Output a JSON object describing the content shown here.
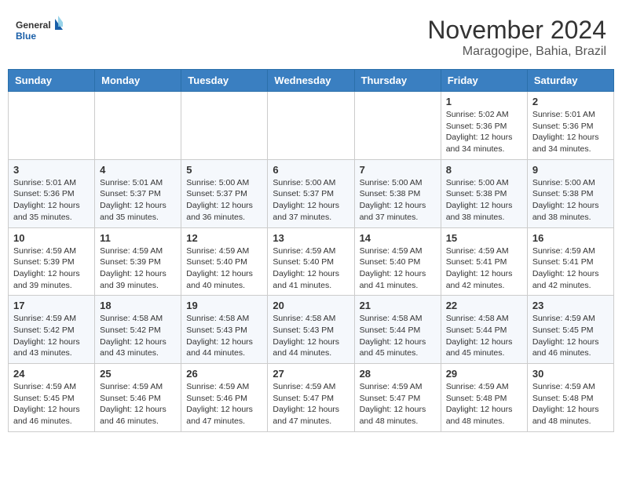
{
  "header": {
    "logo_general": "General",
    "logo_blue": "Blue",
    "month_title": "November 2024",
    "location": "Maragogipe, Bahia, Brazil"
  },
  "days_of_week": [
    "Sunday",
    "Monday",
    "Tuesday",
    "Wednesday",
    "Thursday",
    "Friday",
    "Saturday"
  ],
  "weeks": [
    [
      {
        "day": "",
        "info": ""
      },
      {
        "day": "",
        "info": ""
      },
      {
        "day": "",
        "info": ""
      },
      {
        "day": "",
        "info": ""
      },
      {
        "day": "",
        "info": ""
      },
      {
        "day": "1",
        "info": "Sunrise: 5:02 AM\nSunset: 5:36 PM\nDaylight: 12 hours\nand 34 minutes."
      },
      {
        "day": "2",
        "info": "Sunrise: 5:01 AM\nSunset: 5:36 PM\nDaylight: 12 hours\nand 34 minutes."
      }
    ],
    [
      {
        "day": "3",
        "info": "Sunrise: 5:01 AM\nSunset: 5:36 PM\nDaylight: 12 hours\nand 35 minutes."
      },
      {
        "day": "4",
        "info": "Sunrise: 5:01 AM\nSunset: 5:37 PM\nDaylight: 12 hours\nand 35 minutes."
      },
      {
        "day": "5",
        "info": "Sunrise: 5:00 AM\nSunset: 5:37 PM\nDaylight: 12 hours\nand 36 minutes."
      },
      {
        "day": "6",
        "info": "Sunrise: 5:00 AM\nSunset: 5:37 PM\nDaylight: 12 hours\nand 37 minutes."
      },
      {
        "day": "7",
        "info": "Sunrise: 5:00 AM\nSunset: 5:38 PM\nDaylight: 12 hours\nand 37 minutes."
      },
      {
        "day": "8",
        "info": "Sunrise: 5:00 AM\nSunset: 5:38 PM\nDaylight: 12 hours\nand 38 minutes."
      },
      {
        "day": "9",
        "info": "Sunrise: 5:00 AM\nSunset: 5:38 PM\nDaylight: 12 hours\nand 38 minutes."
      }
    ],
    [
      {
        "day": "10",
        "info": "Sunrise: 4:59 AM\nSunset: 5:39 PM\nDaylight: 12 hours\nand 39 minutes."
      },
      {
        "day": "11",
        "info": "Sunrise: 4:59 AM\nSunset: 5:39 PM\nDaylight: 12 hours\nand 39 minutes."
      },
      {
        "day": "12",
        "info": "Sunrise: 4:59 AM\nSunset: 5:40 PM\nDaylight: 12 hours\nand 40 minutes."
      },
      {
        "day": "13",
        "info": "Sunrise: 4:59 AM\nSunset: 5:40 PM\nDaylight: 12 hours\nand 41 minutes."
      },
      {
        "day": "14",
        "info": "Sunrise: 4:59 AM\nSunset: 5:40 PM\nDaylight: 12 hours\nand 41 minutes."
      },
      {
        "day": "15",
        "info": "Sunrise: 4:59 AM\nSunset: 5:41 PM\nDaylight: 12 hours\nand 42 minutes."
      },
      {
        "day": "16",
        "info": "Sunrise: 4:59 AM\nSunset: 5:41 PM\nDaylight: 12 hours\nand 42 minutes."
      }
    ],
    [
      {
        "day": "17",
        "info": "Sunrise: 4:59 AM\nSunset: 5:42 PM\nDaylight: 12 hours\nand 43 minutes."
      },
      {
        "day": "18",
        "info": "Sunrise: 4:58 AM\nSunset: 5:42 PM\nDaylight: 12 hours\nand 43 minutes."
      },
      {
        "day": "19",
        "info": "Sunrise: 4:58 AM\nSunset: 5:43 PM\nDaylight: 12 hours\nand 44 minutes."
      },
      {
        "day": "20",
        "info": "Sunrise: 4:58 AM\nSunset: 5:43 PM\nDaylight: 12 hours\nand 44 minutes."
      },
      {
        "day": "21",
        "info": "Sunrise: 4:58 AM\nSunset: 5:44 PM\nDaylight: 12 hours\nand 45 minutes."
      },
      {
        "day": "22",
        "info": "Sunrise: 4:58 AM\nSunset: 5:44 PM\nDaylight: 12 hours\nand 45 minutes."
      },
      {
        "day": "23",
        "info": "Sunrise: 4:59 AM\nSunset: 5:45 PM\nDaylight: 12 hours\nand 46 minutes."
      }
    ],
    [
      {
        "day": "24",
        "info": "Sunrise: 4:59 AM\nSunset: 5:45 PM\nDaylight: 12 hours\nand 46 minutes."
      },
      {
        "day": "25",
        "info": "Sunrise: 4:59 AM\nSunset: 5:46 PM\nDaylight: 12 hours\nand 46 minutes."
      },
      {
        "day": "26",
        "info": "Sunrise: 4:59 AM\nSunset: 5:46 PM\nDaylight: 12 hours\nand 47 minutes."
      },
      {
        "day": "27",
        "info": "Sunrise: 4:59 AM\nSunset: 5:47 PM\nDaylight: 12 hours\nand 47 minutes."
      },
      {
        "day": "28",
        "info": "Sunrise: 4:59 AM\nSunset: 5:47 PM\nDaylight: 12 hours\nand 48 minutes."
      },
      {
        "day": "29",
        "info": "Sunrise: 4:59 AM\nSunset: 5:48 PM\nDaylight: 12 hours\nand 48 minutes."
      },
      {
        "day": "30",
        "info": "Sunrise: 4:59 AM\nSunset: 5:48 PM\nDaylight: 12 hours\nand 48 minutes."
      }
    ]
  ]
}
